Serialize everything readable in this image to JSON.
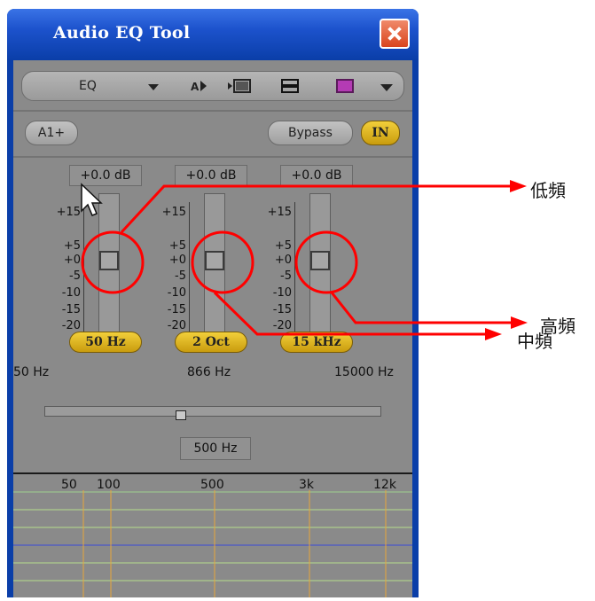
{
  "window": {
    "title": "Audio EQ Tool"
  },
  "toolbar": {
    "mode_label": "EQ"
  },
  "controls": {
    "track_button": "A1+",
    "bypass_button": "Bypass",
    "in_button": "IN"
  },
  "bands": [
    {
      "gain_readout": "+0.0 dB",
      "freq_button": "50 Hz",
      "gain_db": 0
    },
    {
      "gain_readout": "+0.0 dB",
      "freq_button": "2 Oct",
      "gain_db": 0
    },
    {
      "gain_readout": "+0.0 dB",
      "freq_button": "15 kHz",
      "gain_db": 0
    }
  ],
  "scale_labels": [
    "+15",
    "+5",
    "+0",
    "-5",
    "-10",
    "-15",
    "-20"
  ],
  "frequency_slider": {
    "min_label": "50 Hz",
    "mid_label": "866 Hz",
    "max_label": "15000 Hz",
    "value_label": "500 Hz"
  },
  "graph": {
    "x_labels": [
      "50",
      "100",
      "500",
      "3k",
      "12k"
    ]
  },
  "annotations": {
    "low": "低頻",
    "high": "高頻",
    "mid": "中頻"
  },
  "colors": {
    "annotation": "#ff0000",
    "title_bar": "#0a3ea8",
    "band_button": "#e3b520"
  }
}
